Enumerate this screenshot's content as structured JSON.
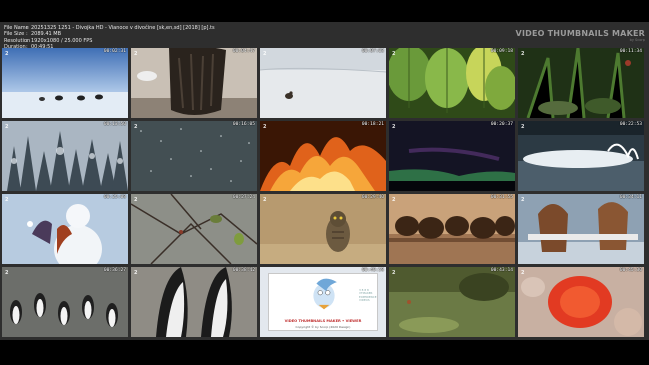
{
  "info": [
    {
      "key": "File Name",
      "value": "20251325 1251 - Divojka HD - Vianoce v divočine [sk,en,sd] [2018] [p].ts"
    },
    {
      "key": "File Size",
      "value": "2089.41 MB"
    },
    {
      "key": "Resolution",
      "value": "1920x1080 / 25.000 FPS"
    },
    {
      "key": "Duration",
      "value": "00:49:51"
    }
  ],
  "brand": {
    "title": "VIDEO THUMBNAILS MAKER",
    "subtitle": "by Scorp"
  },
  "logo_text": "2",
  "card": {
    "title": "VIDEO THUMBNAILS MAKER • VIEWER",
    "copyright": "Copyright © by Scorp (2020 Design)",
    "side": "3 8 8 8\nVTMAKER\nEXPERIENCE\nVIDEOS"
  },
  "thumbnails": [
    {
      "time": "00:02:31",
      "scene": "snow-sky"
    },
    {
      "time": "00:04:47",
      "scene": "bison-fur"
    },
    {
      "time": "00:07:03",
      "scene": "snow-bird"
    },
    {
      "time": "00:09:18",
      "scene": "green-leaves"
    },
    {
      "time": "00:11:34",
      "scene": "forest-floor"
    },
    {
      "time": "00:13:50",
      "scene": "snow-forest"
    },
    {
      "time": "00:16:05",
      "scene": "snowfall"
    },
    {
      "time": "00:18:21",
      "scene": "fire"
    },
    {
      "time": "00:20:37",
      "scene": "aurora"
    },
    {
      "time": "00:22:53",
      "scene": "splash"
    },
    {
      "time": "00:25:08",
      "scene": "snowman"
    },
    {
      "time": "00:27:24",
      "scene": "branches"
    },
    {
      "time": "00:29:40",
      "scene": "owl"
    },
    {
      "time": "00:31:55",
      "scene": "bison-herd"
    },
    {
      "time": "00:34:11",
      "scene": "horses"
    },
    {
      "time": "00:36:27",
      "scene": "penguins"
    },
    {
      "time": "00:38:42",
      "scene": "penguins-close"
    },
    {
      "time": "00:40:58",
      "scene": "card"
    },
    {
      "time": "00:43:14",
      "scene": "meadow"
    },
    {
      "time": "00:45:30",
      "scene": "red-macro"
    }
  ]
}
